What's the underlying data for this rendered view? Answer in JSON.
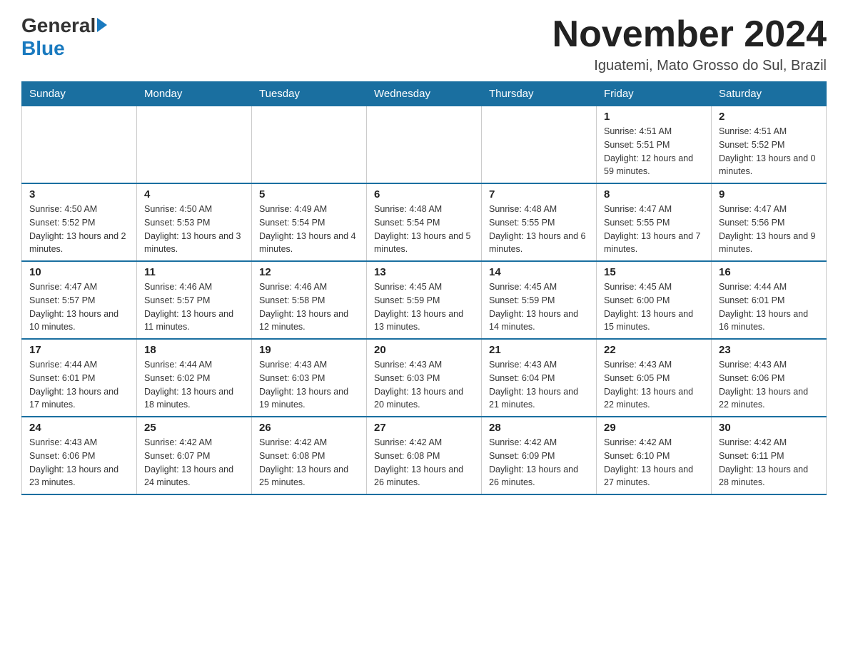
{
  "header": {
    "logo_general": "General",
    "logo_blue": "Blue",
    "month_year": "November 2024",
    "location": "Iguatemi, Mato Grosso do Sul, Brazil"
  },
  "days_of_week": [
    "Sunday",
    "Monday",
    "Tuesday",
    "Wednesday",
    "Thursday",
    "Friday",
    "Saturday"
  ],
  "weeks": [
    {
      "days": [
        {
          "number": "",
          "info": ""
        },
        {
          "number": "",
          "info": ""
        },
        {
          "number": "",
          "info": ""
        },
        {
          "number": "",
          "info": ""
        },
        {
          "number": "",
          "info": ""
        },
        {
          "number": "1",
          "info": "Sunrise: 4:51 AM\nSunset: 5:51 PM\nDaylight: 12 hours and 59 minutes."
        },
        {
          "number": "2",
          "info": "Sunrise: 4:51 AM\nSunset: 5:52 PM\nDaylight: 13 hours and 0 minutes."
        }
      ]
    },
    {
      "days": [
        {
          "number": "3",
          "info": "Sunrise: 4:50 AM\nSunset: 5:52 PM\nDaylight: 13 hours and 2 minutes."
        },
        {
          "number": "4",
          "info": "Sunrise: 4:50 AM\nSunset: 5:53 PM\nDaylight: 13 hours and 3 minutes."
        },
        {
          "number": "5",
          "info": "Sunrise: 4:49 AM\nSunset: 5:54 PM\nDaylight: 13 hours and 4 minutes."
        },
        {
          "number": "6",
          "info": "Sunrise: 4:48 AM\nSunset: 5:54 PM\nDaylight: 13 hours and 5 minutes."
        },
        {
          "number": "7",
          "info": "Sunrise: 4:48 AM\nSunset: 5:55 PM\nDaylight: 13 hours and 6 minutes."
        },
        {
          "number": "8",
          "info": "Sunrise: 4:47 AM\nSunset: 5:55 PM\nDaylight: 13 hours and 7 minutes."
        },
        {
          "number": "9",
          "info": "Sunrise: 4:47 AM\nSunset: 5:56 PM\nDaylight: 13 hours and 9 minutes."
        }
      ]
    },
    {
      "days": [
        {
          "number": "10",
          "info": "Sunrise: 4:47 AM\nSunset: 5:57 PM\nDaylight: 13 hours and 10 minutes."
        },
        {
          "number": "11",
          "info": "Sunrise: 4:46 AM\nSunset: 5:57 PM\nDaylight: 13 hours and 11 minutes."
        },
        {
          "number": "12",
          "info": "Sunrise: 4:46 AM\nSunset: 5:58 PM\nDaylight: 13 hours and 12 minutes."
        },
        {
          "number": "13",
          "info": "Sunrise: 4:45 AM\nSunset: 5:59 PM\nDaylight: 13 hours and 13 minutes."
        },
        {
          "number": "14",
          "info": "Sunrise: 4:45 AM\nSunset: 5:59 PM\nDaylight: 13 hours and 14 minutes."
        },
        {
          "number": "15",
          "info": "Sunrise: 4:45 AM\nSunset: 6:00 PM\nDaylight: 13 hours and 15 minutes."
        },
        {
          "number": "16",
          "info": "Sunrise: 4:44 AM\nSunset: 6:01 PM\nDaylight: 13 hours and 16 minutes."
        }
      ]
    },
    {
      "days": [
        {
          "number": "17",
          "info": "Sunrise: 4:44 AM\nSunset: 6:01 PM\nDaylight: 13 hours and 17 minutes."
        },
        {
          "number": "18",
          "info": "Sunrise: 4:44 AM\nSunset: 6:02 PM\nDaylight: 13 hours and 18 minutes."
        },
        {
          "number": "19",
          "info": "Sunrise: 4:43 AM\nSunset: 6:03 PM\nDaylight: 13 hours and 19 minutes."
        },
        {
          "number": "20",
          "info": "Sunrise: 4:43 AM\nSunset: 6:03 PM\nDaylight: 13 hours and 20 minutes."
        },
        {
          "number": "21",
          "info": "Sunrise: 4:43 AM\nSunset: 6:04 PM\nDaylight: 13 hours and 21 minutes."
        },
        {
          "number": "22",
          "info": "Sunrise: 4:43 AM\nSunset: 6:05 PM\nDaylight: 13 hours and 22 minutes."
        },
        {
          "number": "23",
          "info": "Sunrise: 4:43 AM\nSunset: 6:06 PM\nDaylight: 13 hours and 22 minutes."
        }
      ]
    },
    {
      "days": [
        {
          "number": "24",
          "info": "Sunrise: 4:43 AM\nSunset: 6:06 PM\nDaylight: 13 hours and 23 minutes."
        },
        {
          "number": "25",
          "info": "Sunrise: 4:42 AM\nSunset: 6:07 PM\nDaylight: 13 hours and 24 minutes."
        },
        {
          "number": "26",
          "info": "Sunrise: 4:42 AM\nSunset: 6:08 PM\nDaylight: 13 hours and 25 minutes."
        },
        {
          "number": "27",
          "info": "Sunrise: 4:42 AM\nSunset: 6:08 PM\nDaylight: 13 hours and 26 minutes."
        },
        {
          "number": "28",
          "info": "Sunrise: 4:42 AM\nSunset: 6:09 PM\nDaylight: 13 hours and 26 minutes."
        },
        {
          "number": "29",
          "info": "Sunrise: 4:42 AM\nSunset: 6:10 PM\nDaylight: 13 hours and 27 minutes."
        },
        {
          "number": "30",
          "info": "Sunrise: 4:42 AM\nSunset: 6:11 PM\nDaylight: 13 hours and 28 minutes."
        }
      ]
    }
  ]
}
